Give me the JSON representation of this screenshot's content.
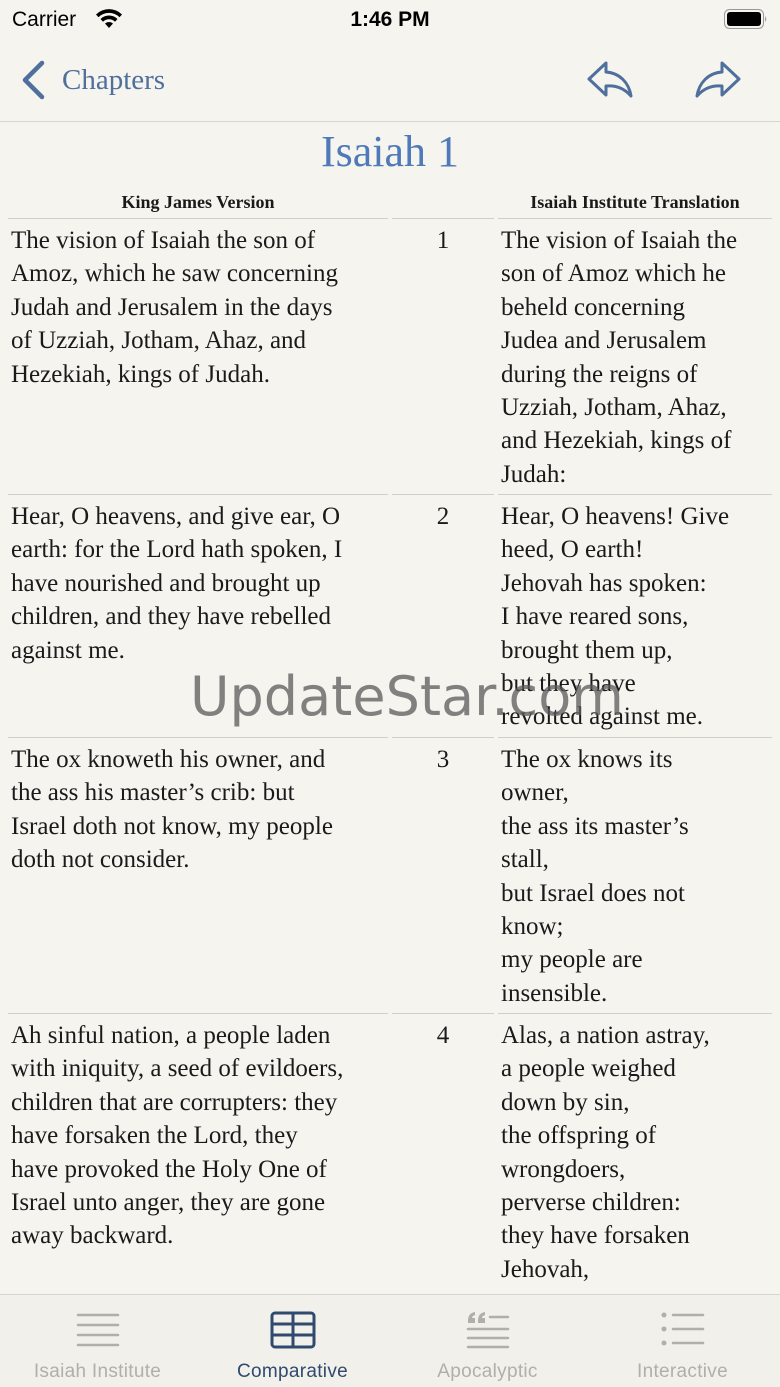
{
  "status_bar": {
    "carrier": "Carrier",
    "time": "1:46 PM"
  },
  "nav": {
    "back_label": "Chapters"
  },
  "title": "Isaiah 1",
  "columns": {
    "left": "King James Version",
    "right": "Isaiah Institute Translation"
  },
  "verses": [
    {
      "num": "1",
      "kjv": "The vision of Isaiah the son of\nAmoz, which he saw concerning\nJudah and Jerusalem in the days\nof Uzziah, Jotham, Ahaz, and\nHezekiah, kings of Judah.",
      "iit": "The vision of Isaiah the\nson of Amoz which he\nbeheld concerning\nJudea and Jerusalem\nduring the reigns of\nUzziah, Jotham, Ahaz,\nand Hezekiah, kings of\nJudah:"
    },
    {
      "num": "2",
      "kjv": "Hear, O heavens, and give ear, O\nearth: for the Lord hath spoken, I\nhave nourished and brought up\nchildren, and they have rebelled\nagainst me.",
      "iit": "Hear, O heavens! Give\nheed, O earth!\n   Jehovah has spoken:\nI have reared sons,\nbrought them up,\n   but they have\n   revolted against me."
    },
    {
      "num": "3",
      "kjv": "The ox knoweth his owner, and\nthe ass his master’s crib: but\nIsrael doth not know, my people\ndoth not consider.",
      "iit": "The ox knows its\nowner,\n   the ass its master’s\n   stall,\nbut Israel does not\nknow;\n   my people are\n   insensible."
    },
    {
      "num": "4",
      "kjv": "Ah sinful nation, a people laden\nwith iniquity, a seed of evildoers,\nchildren that are corrupters: they\nhave forsaken the Lord, they\nhave provoked the Holy One of\nIsrael unto anger, they are gone\naway backward.",
      "iit": "Alas, a nation astray,\n   a people weighed\n   down by sin,\nthe offspring of\nwrongdoers,\n   perverse children:\nthey have forsaken\nJehovah,"
    }
  ],
  "watermark": "UpdateStar.com",
  "tabs": [
    {
      "label": "Isaiah Institute",
      "icon": "lines-icon"
    },
    {
      "label": "Comparative",
      "icon": "table-icon"
    },
    {
      "label": "Apocalyptic",
      "icon": "quote-lines-icon"
    },
    {
      "label": "Interactive",
      "icon": "list-icon"
    }
  ],
  "colors": {
    "accent": "#4f79b8",
    "nav_tint": "#4f6f9c",
    "active_tab": "#2f4a6e",
    "inactive_tab": "#b0afaa",
    "background": "#f5f4ef"
  }
}
